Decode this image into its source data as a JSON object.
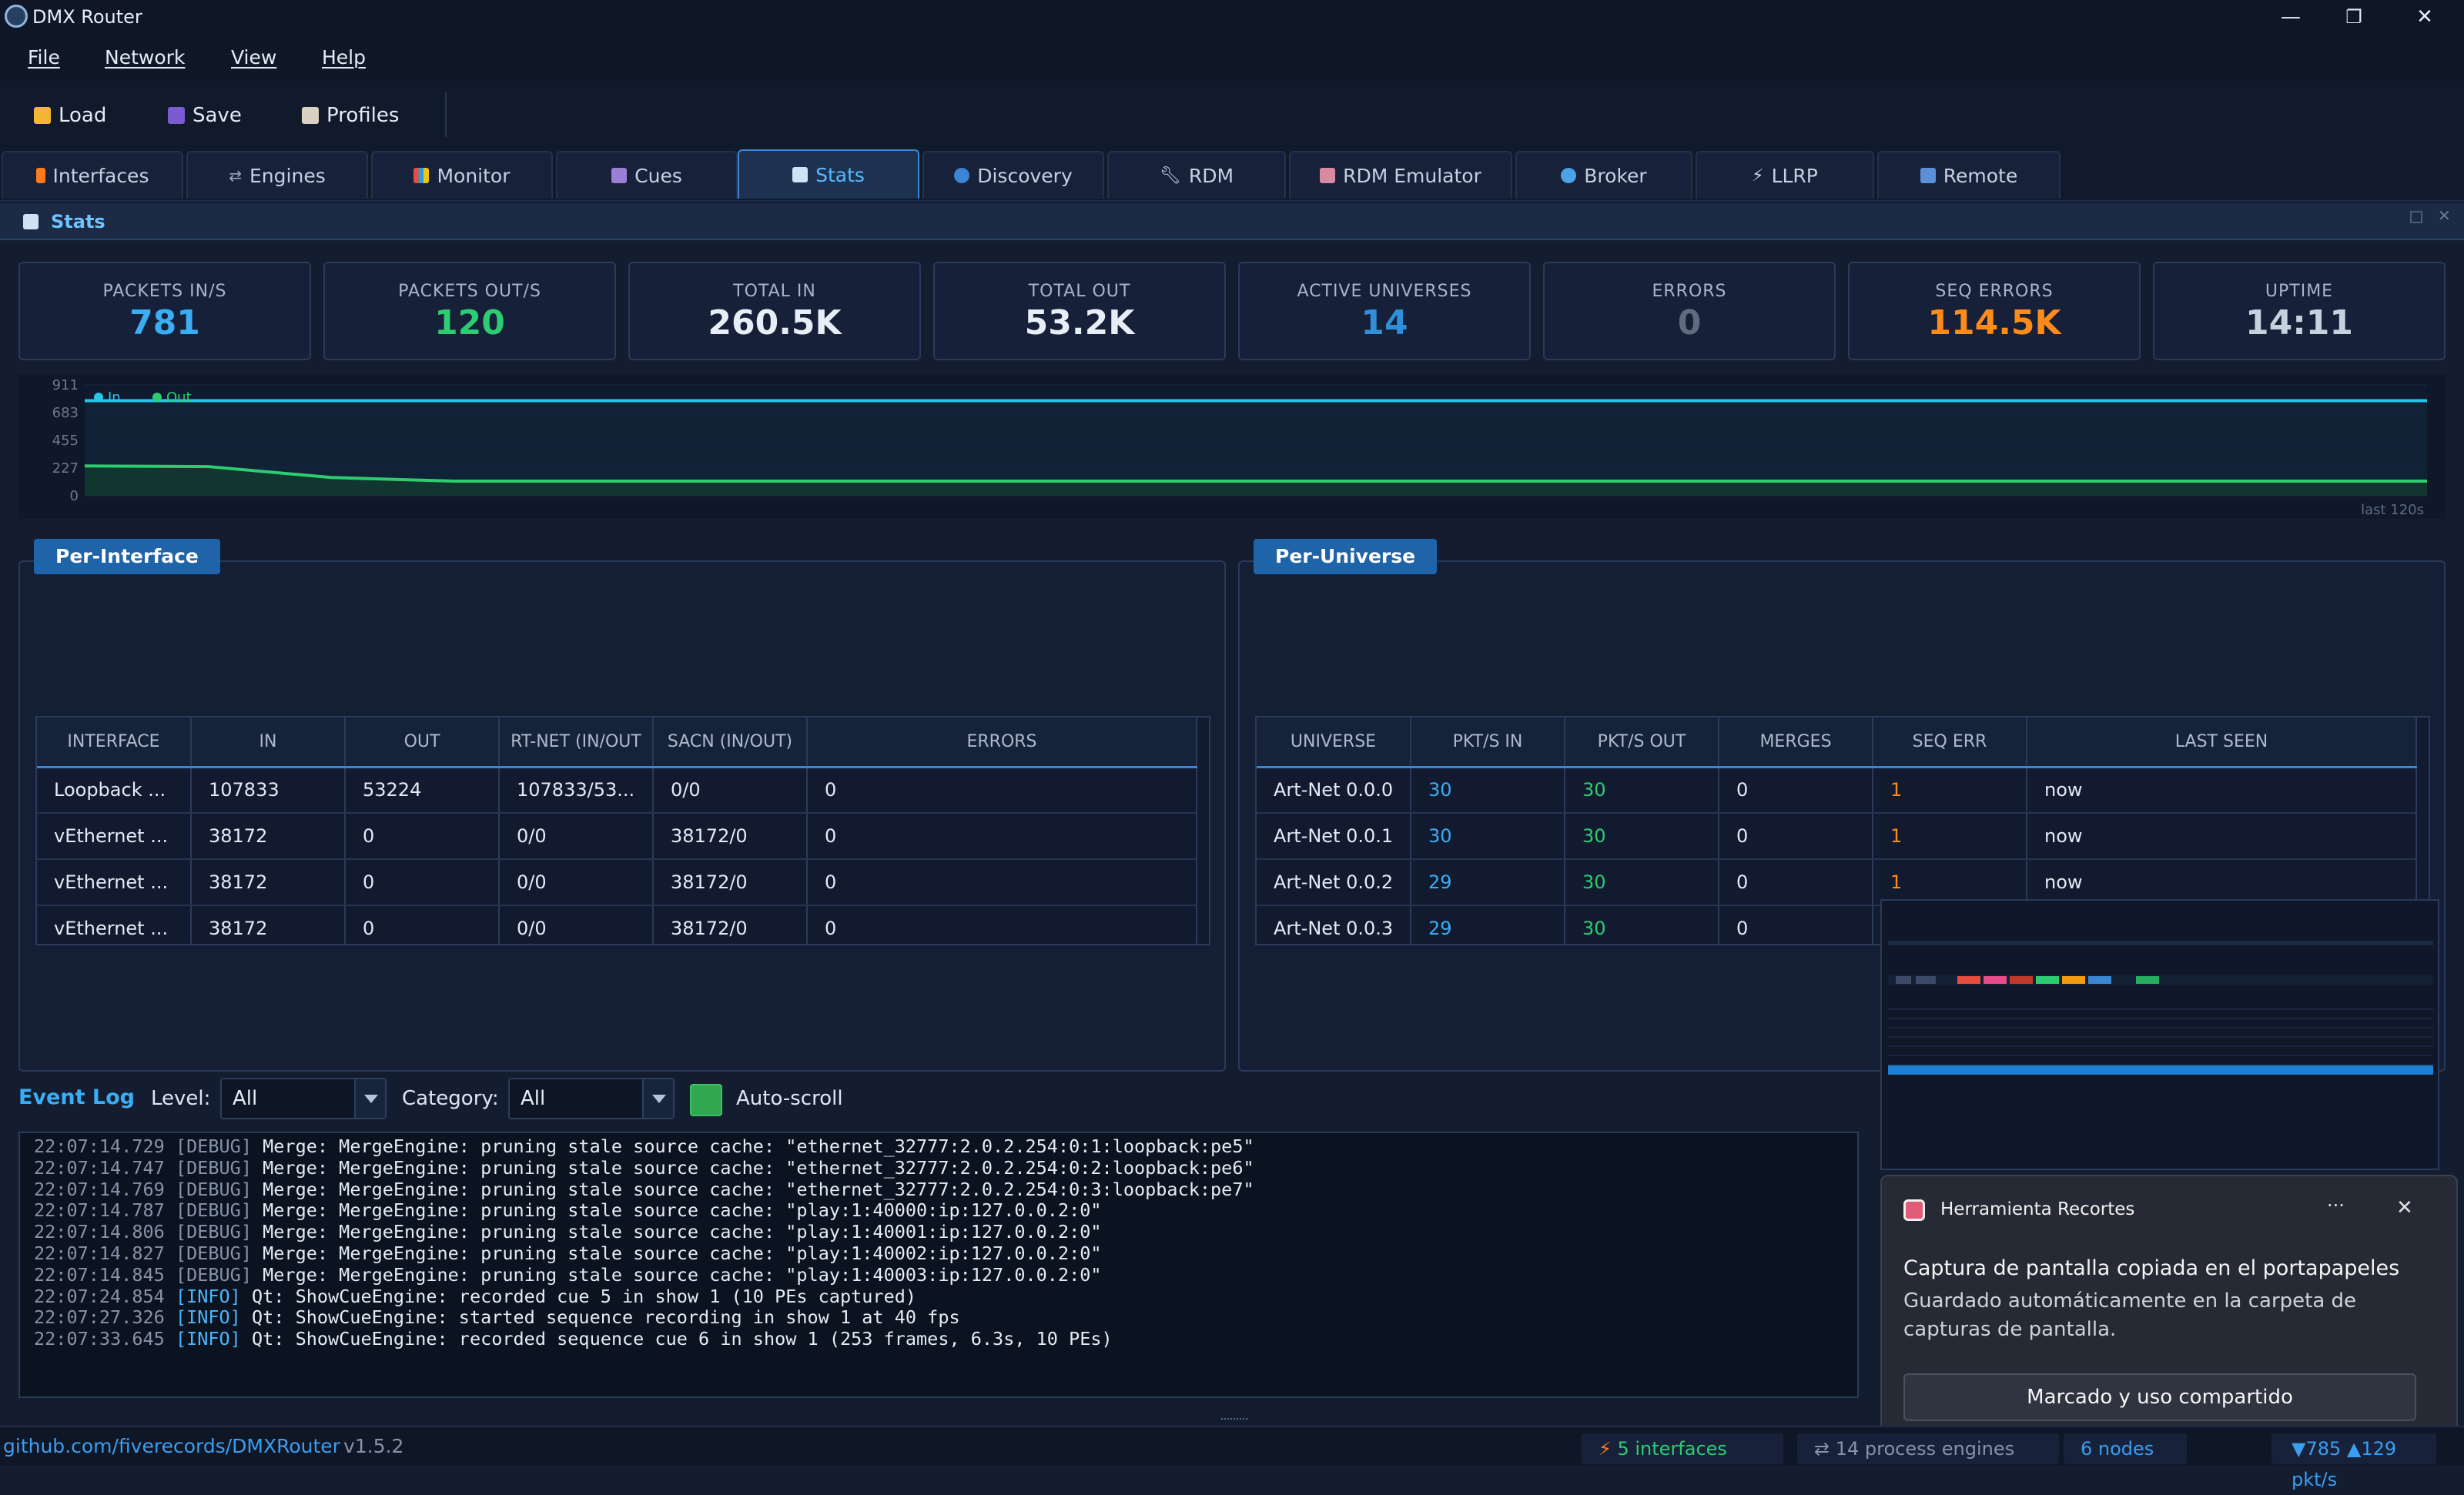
{
  "window": {
    "title": "DMX Router",
    "controls": [
      "—",
      "❐",
      "✕"
    ]
  },
  "menu": [
    "File",
    "Network",
    "View",
    "Help"
  ],
  "toolbar": {
    "load": "Load",
    "save": "Save",
    "profiles": "Profiles"
  },
  "tabs": [
    {
      "label": "Interfaces",
      "icon": "bolt-icon"
    },
    {
      "label": "Engines",
      "icon": "arrows-icon"
    },
    {
      "label": "Monitor",
      "icon": "bar-chart-icon"
    },
    {
      "label": "Cues",
      "icon": "cues-icon"
    },
    {
      "label": "Stats",
      "icon": "line-chart-icon",
      "active": true
    },
    {
      "label": "Discovery",
      "icon": "magnifier-icon"
    },
    {
      "label": "RDM",
      "icon": "wrench-icon"
    },
    {
      "label": "RDM Emulator",
      "icon": "robot-icon"
    },
    {
      "label": "Broker",
      "icon": "globe-icon"
    },
    {
      "label": "LLRP",
      "icon": "plug-icon"
    },
    {
      "label": "Remote",
      "icon": "grid-icon"
    }
  ],
  "panel": {
    "title": "Stats"
  },
  "cards": [
    {
      "label": "PACKETS IN/S",
      "value": "781",
      "color": "#3aaef5"
    },
    {
      "label": "PACKETS OUT/S",
      "value": "120",
      "color": "#2ecc71"
    },
    {
      "label": "TOTAL IN",
      "value": "260.5K",
      "color": "#e8eef8"
    },
    {
      "label": "TOTAL OUT",
      "value": "53.2K",
      "color": "#e8eef8"
    },
    {
      "label": "ACTIVE UNIVERSES",
      "value": "14",
      "color": "#2f8fd8"
    },
    {
      "label": "ERRORS",
      "value": "0",
      "color": "#5f6b7e"
    },
    {
      "label": "SEQ ERRORS",
      "value": "114.5K",
      "color": "#ff8c1a"
    },
    {
      "label": "UPTIME",
      "value": "14:11",
      "color": "#c7d0dd"
    }
  ],
  "chart_data": {
    "type": "line",
    "y_ticks": [
      "911",
      "683",
      "455",
      "227",
      "0"
    ],
    "ylim": [
      0,
      911
    ],
    "legend": [
      "In",
      "Out"
    ],
    "footer": "last 120s",
    "series": [
      {
        "name": "In",
        "color": "#29c4e6",
        "values": [
          781,
          781,
          781,
          781,
          781,
          781,
          781,
          781,
          781,
          781,
          781,
          781,
          781,
          781,
          781,
          781,
          781,
          781,
          781,
          781
        ]
      },
      {
        "name": "Out",
        "color": "#2ecc71",
        "values": [
          245,
          240,
          150,
          120,
          120,
          120,
          120,
          120,
          120,
          120,
          120,
          120,
          120,
          120,
          120,
          120,
          120,
          120,
          120,
          120
        ]
      }
    ]
  },
  "per_interface": {
    "title": "Per-Interface",
    "columns": [
      "INTERFACE",
      "IN",
      "OUT",
      "RT-NET (IN/OUT",
      "SACN (IN/OUT)",
      "ERRORS"
    ],
    "rows": [
      [
        "Loopback ...",
        "107833",
        "53224",
        "107833/53...",
        "0/0",
        "0"
      ],
      [
        "vEthernet ...",
        "38172",
        "0",
        "0/0",
        "38172/0",
        "0"
      ],
      [
        "vEthernet ...",
        "38172",
        "0",
        "0/0",
        "38172/0",
        "0"
      ],
      [
        "vEthernet ...",
        "38172",
        "0",
        "0/0",
        "38172/0",
        "0"
      ]
    ]
  },
  "per_universe": {
    "title": "Per-Universe",
    "columns": [
      "UNIVERSE",
      "PKT/S IN",
      "PKT/S OUT",
      "MERGES",
      "SEQ ERR",
      "LAST SEEN"
    ],
    "rows": [
      [
        "Art-Net 0.0.0",
        "30",
        "30",
        "0",
        "1",
        "now"
      ],
      [
        "Art-Net 0.0.1",
        "30",
        "30",
        "0",
        "1",
        "now"
      ],
      [
        "Art-Net 0.0.2",
        "29",
        "30",
        "0",
        "1",
        "now"
      ],
      [
        "Art-Net 0.0.3",
        "29",
        "30",
        "0",
        "",
        ""
      ]
    ]
  },
  "event_log": {
    "title": "Event Log",
    "level_label": "Level:",
    "level_value": "All",
    "category_label": "Category:",
    "category_value": "All",
    "autoscroll_label": "Auto-scroll",
    "lines": [
      {
        "ts": "22:07:14.729",
        "lvl": "[DEBUG]",
        "msg": " Merge: MergeEngine: pruning stale source cache: \"ethernet_32777:2.0.2.254:0:1:loopback:pe5\""
      },
      {
        "ts": "22:07:14.747",
        "lvl": "[DEBUG]",
        "msg": " Merge: MergeEngine: pruning stale source cache: \"ethernet_32777:2.0.2.254:0:2:loopback:pe6\""
      },
      {
        "ts": "22:07:14.769",
        "lvl": "[DEBUG]",
        "msg": " Merge: MergeEngine: pruning stale source cache: \"ethernet_32777:2.0.2.254:0:3:loopback:pe7\""
      },
      {
        "ts": "22:07:14.787",
        "lvl": "[DEBUG]",
        "msg": " Merge: MergeEngine: pruning stale source cache: \"play:1:40000:ip:127.0.0.2:0\""
      },
      {
        "ts": "22:07:14.806",
        "lvl": "[DEBUG]",
        "msg": " Merge: MergeEngine: pruning stale source cache: \"play:1:40001:ip:127.0.0.2:0\""
      },
      {
        "ts": "22:07:14.827",
        "lvl": "[DEBUG]",
        "msg": " Merge: MergeEngine: pruning stale source cache: \"play:1:40002:ip:127.0.0.2:0\""
      },
      {
        "ts": "22:07:14.845",
        "lvl": "[DEBUG]",
        "msg": " Merge: MergeEngine: pruning stale source cache: \"play:1:40003:ip:127.0.0.2:0\""
      },
      {
        "ts": "22:07:24.854",
        "lvl": "[INFO]",
        "msg": " Qt: ShowCueEngine: recorded cue 5 in show 1 (10 PEs captured)"
      },
      {
        "ts": "22:07:27.326",
        "lvl": "[INFO]",
        "msg": " Qt: ShowCueEngine: started sequence recording in show 1 at 40 fps"
      },
      {
        "ts": "22:07:33.645",
        "lvl": "[INFO]",
        "msg": " Qt: ShowCueEngine: recorded sequence cue 6 in show 1 (253 frames, 6.3s, 10 PEs)"
      }
    ]
  },
  "status": {
    "repo": "github.com/fiverecords/DMXRouter",
    "version": "v1.5.2",
    "interfaces": "5 interfaces",
    "engines": "14 process engines",
    "nodes": "6 nodes",
    "rates": "▼785 ▲129 pkt/s"
  },
  "toast": {
    "app": "Herramienta Recortes",
    "more": "···",
    "close": "✕",
    "headline": "Captura de pantalla copiada en el portapapeles",
    "body": "Guardado automáticamente en la carpeta de capturas de pantalla.",
    "button": "Marcado y uso compartido"
  }
}
